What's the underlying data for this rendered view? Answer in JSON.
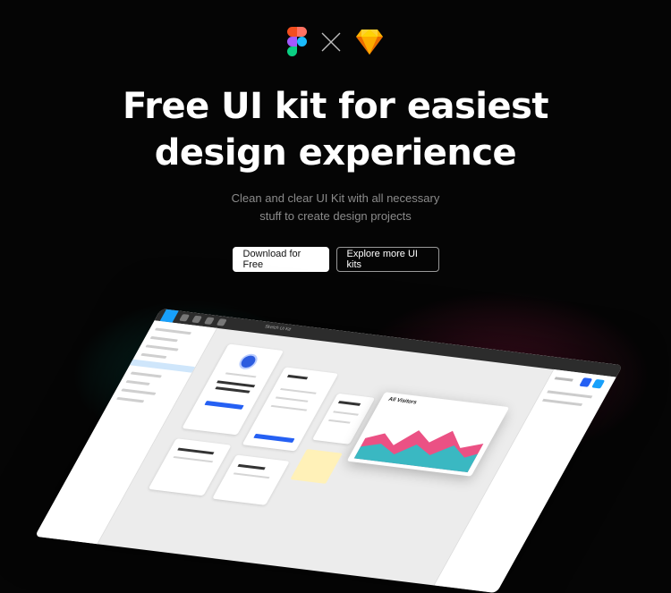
{
  "header": {
    "logos": [
      {
        "name": "figma-logo",
        "colors": [
          "#f24e1e",
          "#ff7262",
          "#a259ff",
          "#1abcfe",
          "#0acf83"
        ]
      },
      {
        "name": "sketch-logo",
        "colors": [
          "#fdb300",
          "#ea6c00",
          "#fdad00",
          "#fdd231"
        ]
      }
    ],
    "separator": "×"
  },
  "hero": {
    "headline_line1": "Free UI kit for easiest",
    "headline_line2": "design experience",
    "subtitle_line1": "Clean and clear UI Kit with all necessary",
    "subtitle_line2": "stuff to create design projects"
  },
  "actions": {
    "primary_label": "Download for Free",
    "secondary_label": "Explore more UI kits"
  },
  "mockup": {
    "editor_title": "Sketch UI Kit",
    "chart_title": "All Visitors",
    "colors": {
      "accent": "#18a0fb",
      "blue": "#2560f3",
      "pink": "#e8336e",
      "teal": "#27c3c9"
    }
  },
  "colors": {
    "background": "#050505",
    "text": "#ffffff",
    "muted": "#8b8b8b"
  }
}
